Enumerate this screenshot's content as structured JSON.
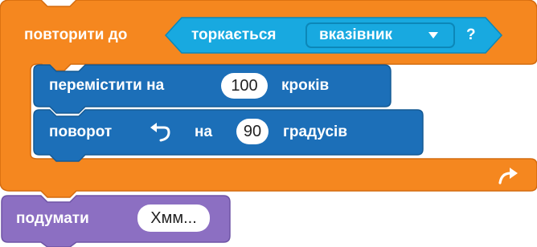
{
  "repeat_until": {
    "label": "повторити до",
    "loop_arrow_icon": "loop-arrow-icon",
    "condition": {
      "label": "торкається",
      "dropdown": {
        "value": "вказівник",
        "icon": "dropdown-arrow-icon"
      },
      "question_mark": "?"
    }
  },
  "move_block": {
    "label_before": "перемістити на",
    "steps": "100",
    "label_after": "кроків"
  },
  "turn_block": {
    "label": "поворот",
    "direction_icon": "turn-left-icon",
    "label_mid": "на",
    "degrees": "90",
    "label_after": "градусів"
  },
  "think_block": {
    "label": "подумати",
    "message": "Хмм..."
  },
  "colors": {
    "control": "#F5871F",
    "control_dark": "#D46B0F",
    "sensing": "#18A9E0",
    "sensing_dark": "#0C87B8",
    "motion": "#1C6FB8",
    "motion_dark": "#155A94",
    "looks": "#8C6FC2",
    "looks_dark": "#6E54A5"
  }
}
